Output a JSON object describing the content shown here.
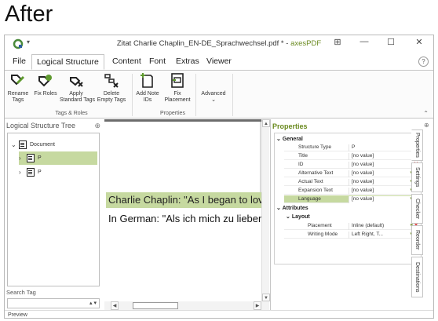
{
  "heading": "After",
  "window": {
    "title_prefix": "Zitat Charlie Chaplin_EN-DE_Sprachwechsel.pdf * - ",
    "title_app": "axesPDF",
    "controls": {
      "grid": "⊞",
      "minimize": "—",
      "maximize": "☐",
      "close": "✕"
    }
  },
  "tabs": [
    {
      "label": "File"
    },
    {
      "label": "Logical Structure"
    },
    {
      "label": "Content"
    },
    {
      "label": "Font"
    },
    {
      "label": "Extras"
    },
    {
      "label": "Viewer"
    }
  ],
  "ribbon": {
    "buttons": {
      "rename_tags": "Rename\nTags",
      "fix_roles": "Fix Roles",
      "apply_standard_tags": "Apply\nStandard Tags",
      "delete_empty_tags": "Delete\nEmpty Tags",
      "add_note_ids": "Add Note\nIDs",
      "fix_placement": "Fix Placement",
      "advanced": "Advanced"
    },
    "groups": {
      "tags_roles": "Tags & Roles",
      "properties": "Properties"
    }
  },
  "left_panel": {
    "title": "Logical Structure Tree",
    "tree": [
      {
        "label": "Document"
      },
      {
        "label": "P"
      },
      {
        "label": "P"
      }
    ],
    "search_label": "Search Tag",
    "search_value": ""
  },
  "document": {
    "line1": "Charlie Chaplin: \"As I began to lov",
    "line2": "In German: \"Als ich mich zu lieber"
  },
  "preview_label": "Preview",
  "properties": {
    "title": "Properties",
    "sections": {
      "general": "General",
      "attributes": "Attributes",
      "layout": "Layout"
    },
    "general_rows": [
      {
        "name": "Structure Type",
        "value": "P"
      },
      {
        "name": "Title",
        "value": "[no value]"
      },
      {
        "name": "ID",
        "value": "[no value]"
      },
      {
        "name": "Alternative Text",
        "value": "[no value]"
      },
      {
        "name": "Actual Text",
        "value": "[no value]"
      },
      {
        "name": "Expansion Text",
        "value": "[no value]"
      },
      {
        "name": "Language",
        "value": "[no value]"
      }
    ],
    "layout_rows": [
      {
        "name": "Placement",
        "value": "Inline (default)"
      },
      {
        "name": "Writing Mode",
        "value": "Left Right, T..."
      }
    ],
    "side_tabs": [
      "Properties",
      "Settings",
      "Checker",
      "Reorder",
      "Destinations"
    ]
  },
  "colors": {
    "accent": "#6a8a1f",
    "highlight": "#c6d9a0",
    "delete": "#dd2222"
  }
}
